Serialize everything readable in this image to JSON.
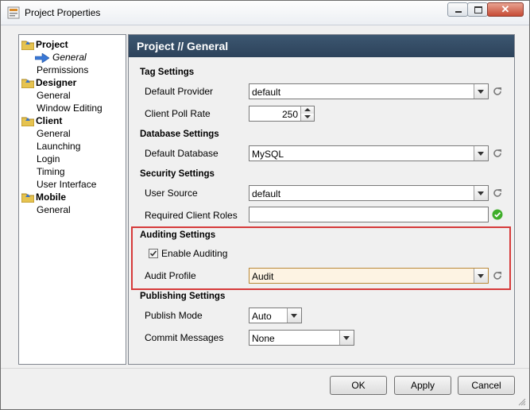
{
  "window": {
    "title": "Project Properties"
  },
  "tree": {
    "groups": [
      {
        "label": "Project",
        "items": [
          "General",
          "Permissions"
        ]
      },
      {
        "label": "Designer",
        "items": [
          "General",
          "Window Editing"
        ]
      },
      {
        "label": "Client",
        "items": [
          "General",
          "Launching",
          "Login",
          "Timing",
          "User Interface"
        ]
      },
      {
        "label": "Mobile",
        "items": [
          "General"
        ]
      }
    ]
  },
  "panel": {
    "header": "Project // General",
    "tag_settings": {
      "title": "Tag Settings",
      "default_provider_label": "Default Provider",
      "default_provider_value": "default",
      "client_poll_rate_label": "Client Poll Rate",
      "client_poll_rate_value": "250"
    },
    "database_settings": {
      "title": "Database Settings",
      "default_database_label": "Default Database",
      "default_database_value": "MySQL"
    },
    "security_settings": {
      "title": "Security Settings",
      "user_source_label": "User Source",
      "user_source_value": "default",
      "required_roles_label": "Required Client Roles",
      "required_roles_value": ""
    },
    "auditing_settings": {
      "title": "Auditing Settings",
      "enable_auditing_label": "Enable Auditing",
      "audit_profile_label": "Audit Profile",
      "audit_profile_value": "Audit"
    },
    "publishing_settings": {
      "title": "Publishing Settings",
      "publish_mode_label": "Publish Mode",
      "publish_mode_value": "Auto",
      "commit_messages_label": "Commit Messages",
      "commit_messages_value": "None"
    }
  },
  "buttons": {
    "ok": "OK",
    "apply": "Apply",
    "cancel": "Cancel"
  }
}
